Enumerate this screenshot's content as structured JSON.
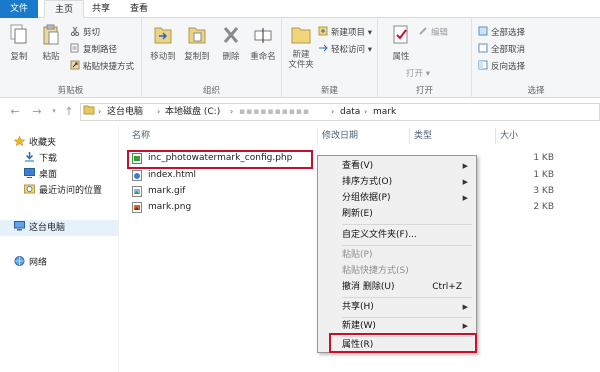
{
  "tabs": {
    "file": "文件",
    "home": "主页",
    "share": "共享",
    "view": "查看"
  },
  "ribbon": {
    "clipboard": {
      "label": "剪贴板",
      "copy": "复制",
      "paste": "粘贴",
      "cut": "剪切",
      "copy_path": "复制路径",
      "paste_shortcut": "粘贴快捷方式"
    },
    "organize": {
      "label": "组织",
      "move_to": "移动到",
      "copy_to": "复制到",
      "delete": "删除",
      "rename": "重命名"
    },
    "new": {
      "label": "新建",
      "new_folder": "新建\n文件夹",
      "new_item": "新建项目 ▾",
      "easy_access": "轻松访问 ▾"
    },
    "open": {
      "label": "打开",
      "properties": "属性",
      "open": "打开 ▾",
      "edit": "编辑"
    },
    "select": {
      "label": "选择",
      "select_all": "全部选择",
      "select_none": "全部取消",
      "invert": "反向选择"
    }
  },
  "address": {
    "crumbs": [
      "这台电脑",
      "本地磁盘 (C:)",
      "▪▪▪▪▪▪▪▪▪▪",
      "data",
      "mark"
    ]
  },
  "nav": {
    "favorites": "收藏夹",
    "downloads": "下载",
    "desktop": "桌面",
    "recent": "最近访问的位置",
    "this_pc": "这台电脑",
    "network": "网络"
  },
  "columns": {
    "name": "名称",
    "date": "修改日期",
    "type": "类型",
    "size": "大小"
  },
  "files": [
    {
      "name": "inc_photowatermark_config.php",
      "size": "1 KB",
      "icon": "php-file-icon"
    },
    {
      "name": "index.html",
      "size": "1 KB",
      "icon": "html-file-icon"
    },
    {
      "name": "mark.gif",
      "size": "3 KB",
      "icon": "gif-file-icon"
    },
    {
      "name": "mark.png",
      "size": "2 KB",
      "icon": "png-file-icon"
    }
  ],
  "context_menu": {
    "view": "查看(V)",
    "sort": "排序方式(O)",
    "group": "分组依据(P)",
    "refresh": "刷新(E)",
    "customize": "自定义文件夹(F)...",
    "paste": "粘贴(P)",
    "paste_shortcut": "粘贴快捷方式(S)",
    "undo_delete": "撤消 删除(U)",
    "undo_shortcut": "Ctrl+Z",
    "share": "共享(H)",
    "new": "新建(W)",
    "properties": "属性(R)"
  },
  "colors": {
    "accent": "#1979ca",
    "highlight": "#c8102e",
    "selection": "#e5f1fb"
  }
}
